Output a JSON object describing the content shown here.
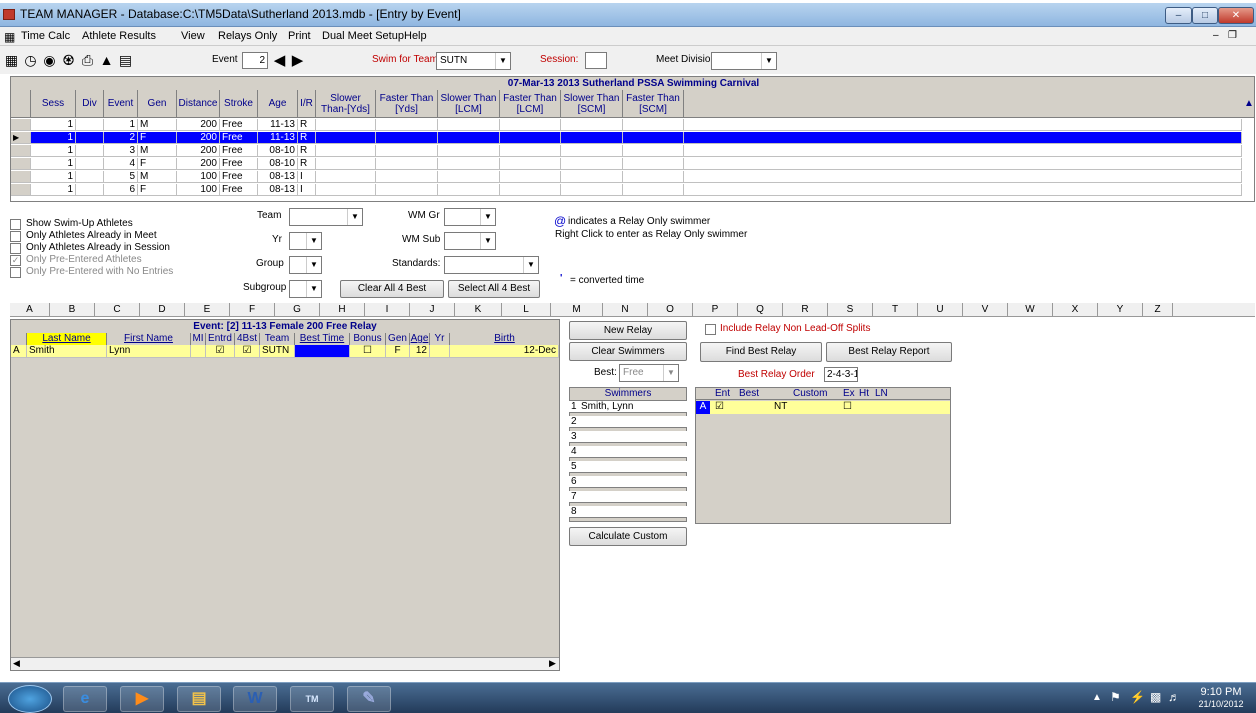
{
  "window": {
    "title": "TEAM MANAGER - Database:C:\\TM5Data\\Sutherland 2013.mdb - [Entry by Event]"
  },
  "menu": [
    "Time Calc",
    "Athlete Results",
    "View",
    "Relays Only",
    "Print",
    "Dual Meet Setup",
    "Help"
  ],
  "toolbar": {
    "event_label": "Event",
    "event_value": "2",
    "swim_for_team_label": "Swim for Team:",
    "swim_for_team_value": "SUTN",
    "session_label": "Session:",
    "session_value": "",
    "meet_division_label": "Meet Division",
    "meet_division_value": ""
  },
  "events_grid": {
    "title": "07-Mar-13  2013 Sutherland PSSA Swimming Carnival",
    "headers": [
      "Sess",
      "Div",
      "Event",
      "Gen",
      "Distance",
      "Stroke",
      "Age",
      "I/R",
      "Slower Than-[Yds]",
      "Faster Than [Yds]",
      "Slower Than [LCM]",
      "Faster Than [LCM]",
      "Slower Than [SCM]",
      "Faster Than [SCM]"
    ],
    "rows": [
      [
        "1",
        "",
        "1",
        "M",
        "200",
        "Free",
        "11-13",
        "R"
      ],
      [
        "1",
        "",
        "2",
        "F",
        "200",
        "Free",
        "11-13",
        "R"
      ],
      [
        "1",
        "",
        "3",
        "M",
        "200",
        "Free",
        "08-10",
        "R"
      ],
      [
        "1",
        "",
        "4",
        "F",
        "200",
        "Free",
        "08-10",
        "R"
      ],
      [
        "1",
        "",
        "5",
        "M",
        "100",
        "Free",
        "08-13",
        "I"
      ],
      [
        "1",
        "",
        "6",
        "F",
        "100",
        "Free",
        "08-13",
        "I"
      ]
    ],
    "selected_row": 1
  },
  "filters": {
    "show_swim_up": "Show Swim-Up Athletes",
    "only_in_meet": "Only Athletes Already in Meet",
    "only_in_session": "Only Athletes Already in Session",
    "only_pre_entered": "Only Pre-Entered Athletes",
    "only_pre_entered_no_entries": "Only Pre-Entered with No Entries",
    "team_label": "Team",
    "yr_label": "Yr",
    "group_label": "Group",
    "subgroup_label": "Subgroup",
    "wm_gr_label": "WM Gr",
    "wm_sub_label": "WM Sub",
    "standards_label": "Standards:",
    "clear_all_4_best": "Clear All 4 Best",
    "select_all_4_best": "Select All 4 Best",
    "relay_only_note_symbol": "@",
    "relay_only_note": "indicates a Relay Only swimmer",
    "right_click_note": "Right Click to enter as Relay Only swimmer",
    "converted_symbol": "'",
    "converted_note": "= converted time"
  },
  "sheet_cols": [
    "A",
    "B",
    "C",
    "D",
    "E",
    "F",
    "G",
    "H",
    "I",
    "J",
    "K",
    "L",
    "M",
    "N",
    "O",
    "P",
    "Q",
    "R",
    "S",
    "T",
    "U",
    "V",
    "W",
    "X",
    "Y",
    "Z"
  ],
  "athletes": {
    "title": "Event: [2]  11-13 Female  200 Free Relay",
    "headers": [
      "Last Name",
      "First Name",
      "MI",
      "Entrd",
      "4Bst",
      "Team",
      "Best Time",
      "Bonus",
      "Gen",
      "Age",
      "Yr",
      "Birth"
    ],
    "rows": [
      {
        "rowlabel": "A",
        "last": "Smith",
        "first": "Lynn",
        "mi": "",
        "entrd": true,
        "best4": true,
        "team": "SUTN",
        "best_time": "",
        "bonus": false,
        "gen": "F",
        "age": "12",
        "yr": "",
        "birth": "12-Dec"
      }
    ]
  },
  "relay": {
    "new_relay": "New Relay",
    "clear_swimmers": "Clear Swimmers",
    "best_label": "Best:",
    "best_value": "Free",
    "swimmers_header": "Swimmers",
    "swimmers": [
      "Smith, Lynn",
      "",
      "",
      "",
      "",
      "",
      "",
      ""
    ],
    "calculate_custom": "Calculate Custom",
    "include_non_leadoff": "Include Relay Non Lead-Off Splits",
    "find_best_relay": "Find Best Relay",
    "best_relay_report": "Best Relay Report",
    "best_relay_order_label": "Best Relay Order",
    "best_relay_order_value": "2-4-3-1",
    "relay_headers": [
      "Ent",
      "Best",
      "Custom",
      "Ex",
      "Ht",
      "LN"
    ],
    "relay_rows": [
      {
        "label": "A",
        "ent": true,
        "best": "NT",
        "custom": "",
        "ex": false,
        "ht": "",
        "ln": ""
      }
    ]
  },
  "taskbar": {
    "time": "9:10 PM",
    "date": "21/10/2012"
  },
  "colors": {
    "selection": "#0000ff",
    "highlight": "#ffff99",
    "header_text": "#00008b",
    "taskbar": "#2b4668"
  }
}
